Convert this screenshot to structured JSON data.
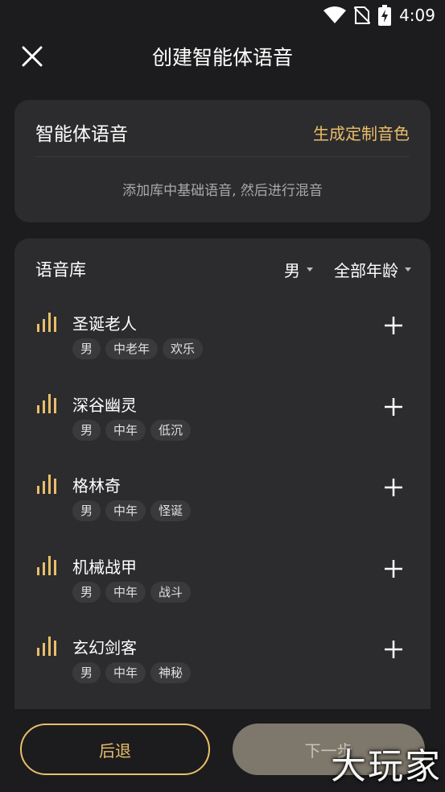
{
  "status_bar": {
    "time": "4:09",
    "icons": [
      "wifi-icon",
      "no-sim-icon",
      "battery-charging-icon"
    ]
  },
  "app_bar": {
    "title": "创建智能体语音",
    "close_icon": "close-icon"
  },
  "agent_voice_card": {
    "title": "智能体语音",
    "action_label": "生成定制音色",
    "hint": "添加库中基础语音, 然后进行混音"
  },
  "voice_library": {
    "title": "语音库",
    "filters": [
      {
        "label": "男"
      },
      {
        "label": "全部年龄"
      }
    ],
    "items": [
      {
        "name": "圣诞老人",
        "tags": [
          "男",
          "中老年",
          "欢乐"
        ]
      },
      {
        "name": "深谷幽灵",
        "tags": [
          "男",
          "中年",
          "低沉"
        ]
      },
      {
        "name": "格林奇",
        "tags": [
          "男",
          "中年",
          "怪诞"
        ]
      },
      {
        "name": "机械战甲",
        "tags": [
          "男",
          "中年",
          "战斗"
        ]
      },
      {
        "name": "玄幻剑客",
        "tags": [
          "男",
          "中年",
          "神秘"
        ]
      }
    ]
  },
  "bottom_bar": {
    "back_label": "后退",
    "next_label": "下一步"
  },
  "watermark": "大玩家",
  "colors": {
    "background": "#1c1c1e",
    "card": "#2c2c2e",
    "accent_gold": "#e9be6a",
    "tag_bg": "#3a3a3c",
    "disabled_button": "#7e776b"
  }
}
